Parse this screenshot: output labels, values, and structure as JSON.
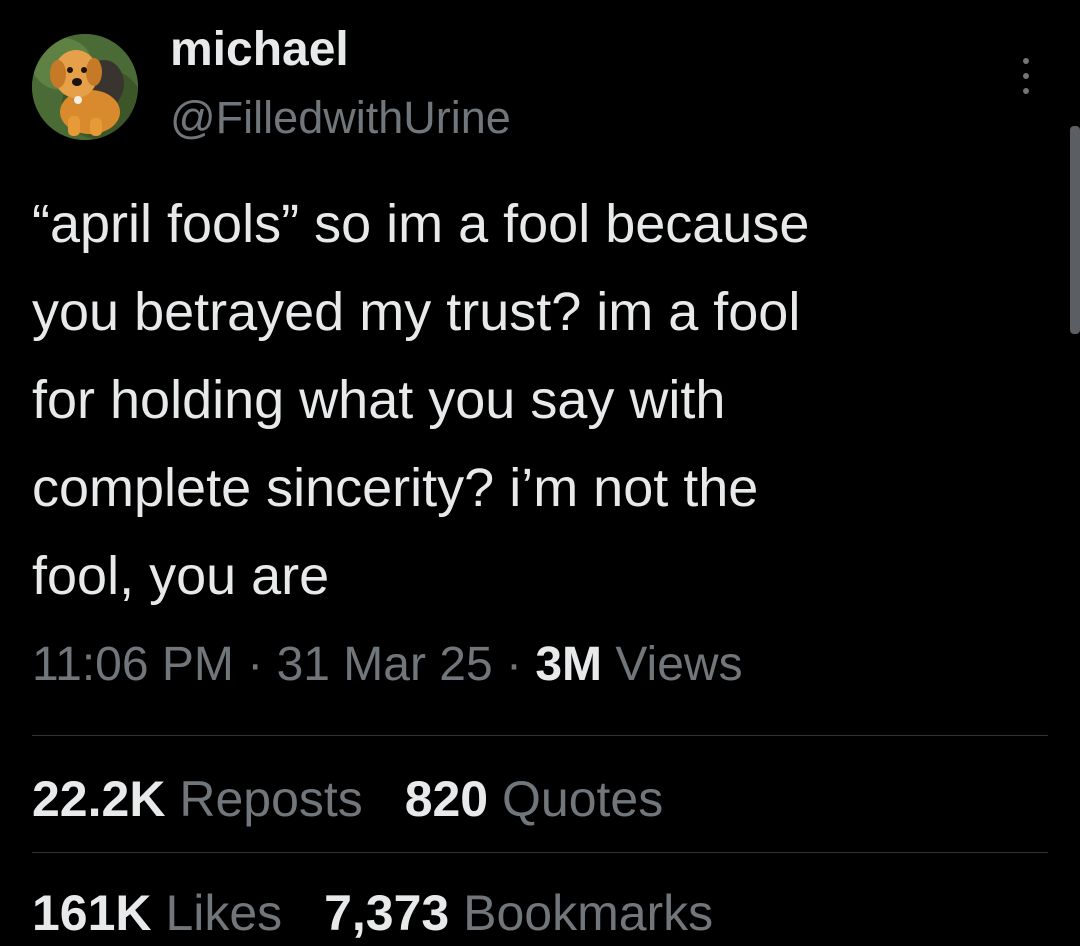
{
  "author": {
    "display_name": "michael",
    "handle": "@FilledwithUrine",
    "avatar_icon": "plush-dog-avatar"
  },
  "tweet": {
    "text": "“april fools” so im a fool because\nyou betrayed my trust? im a fool\nfor holding what you say with\ncomplete sincerity? i’m not the\nfool, you are"
  },
  "meta": {
    "time": "11:06 PM",
    "date": "31 Mar 25",
    "separator": "·",
    "views_count": "3M",
    "views_label": "Views"
  },
  "stats": {
    "reposts_count": "22.2K",
    "reposts_label": "Reposts",
    "quotes_count": "820",
    "quotes_label": "Quotes",
    "likes_count": "161K",
    "likes_label": "Likes",
    "bookmarks_count": "7,373",
    "bookmarks_label": "Bookmarks"
  },
  "icons": {
    "more": "more-options-icon"
  },
  "colors": {
    "background": "#000000",
    "primary_text": "#e7e9ea",
    "secondary_text": "#71767b",
    "divider": "#2f3336"
  }
}
